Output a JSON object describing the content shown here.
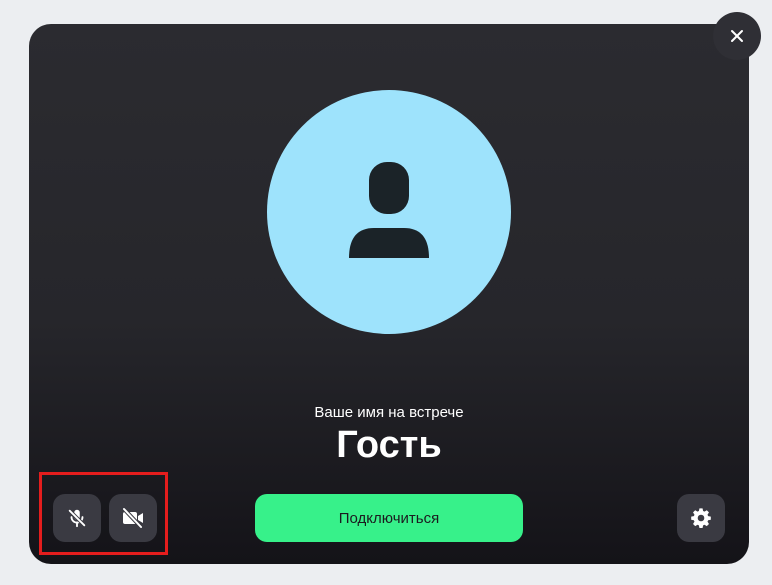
{
  "preview": {
    "name_caption": "Ваше имя на встрече",
    "name_value": "Гость"
  },
  "controls": {
    "join_label": "Подключиться",
    "microphone": "off",
    "camera": "off"
  },
  "icons": {
    "close": "close-icon",
    "avatar": "user-silhouette-icon",
    "microphone": "microphone-off-icon",
    "camera": "camera-off-icon",
    "settings": "gear-icon"
  },
  "colors": {
    "background": "#eceef1",
    "card": "#26262b",
    "avatar": "#9ee3fc",
    "join_button": "#37f18a",
    "control_button": "#3a3a42",
    "highlight": "#e41d1d"
  }
}
